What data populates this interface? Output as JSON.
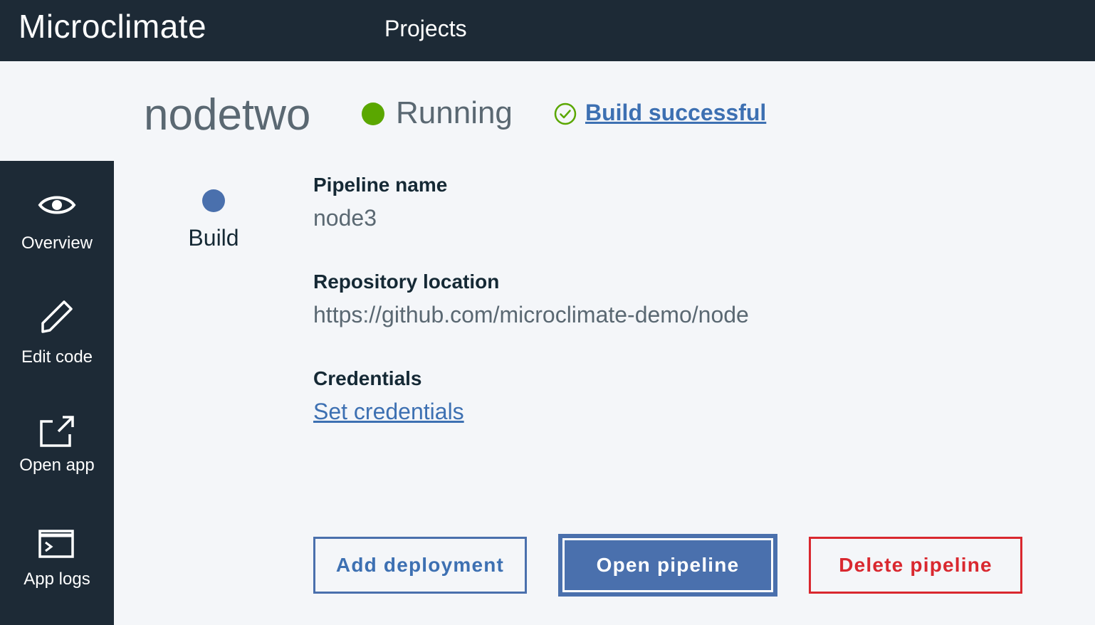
{
  "app": {
    "title": "Microclimate",
    "nav": {
      "projects_label": "Projects"
    }
  },
  "project": {
    "name": "nodetwo",
    "status": "Running",
    "build_status": "Build successful"
  },
  "sidebar": {
    "items": [
      {
        "label": "Overview",
        "icon": "eye-icon"
      },
      {
        "label": "Edit code",
        "icon": "pencil-icon"
      },
      {
        "label": "Open app",
        "icon": "launch-icon"
      },
      {
        "label": "App logs",
        "icon": "terminal-icon"
      }
    ]
  },
  "pipeline": {
    "stage_label": "Build",
    "name_label": "Pipeline name",
    "name_value": "node3",
    "repo_label": "Repository location",
    "repo_value": "https://github.com/microclimate-demo/node",
    "credentials_label": "Credentials",
    "credentials_link": "Set credentials"
  },
  "actions": {
    "add_deployment": "Add deployment",
    "open_pipeline": "Open pipeline",
    "delete_pipeline": "Delete pipeline"
  },
  "colors": {
    "topbar": "#1d2a36",
    "running": "#5aa700",
    "success": "#5aa700",
    "link": "#3d70b2",
    "stage": "#4a70ad",
    "danger": "#d9282f"
  }
}
